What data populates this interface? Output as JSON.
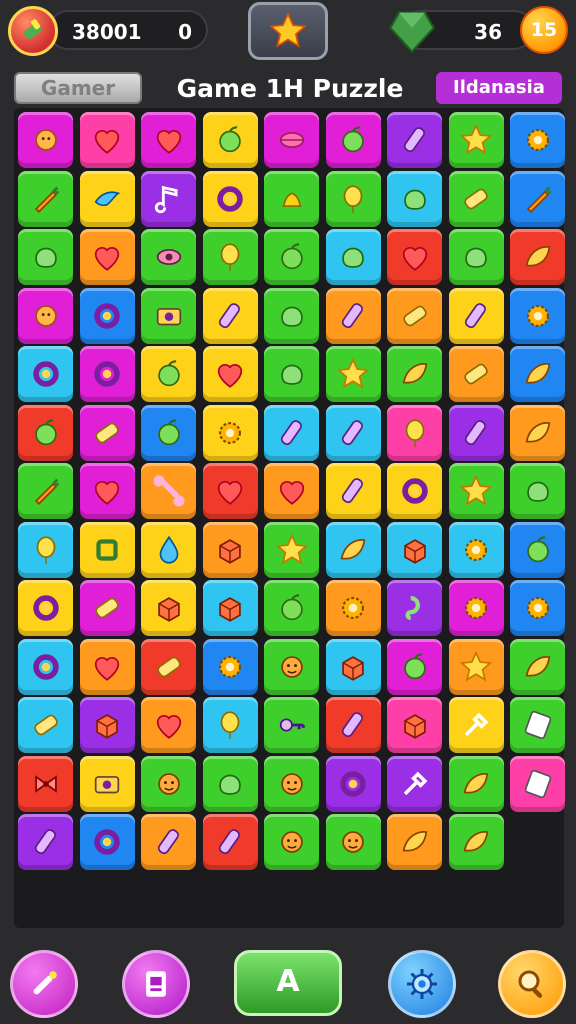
{
  "hud": {
    "score": "38001",
    "score_secondary": "0",
    "gems": "36",
    "coins": "15"
  },
  "header": {
    "games_label": "Gamer",
    "title": "Game 1H Puzzle",
    "region_label": "Ildanasia"
  },
  "board": {
    "cols": 9,
    "rows": 14,
    "tiles": [
      [
        "magenta",
        "flower"
      ],
      [
        "pink",
        "heart"
      ],
      [
        "magenta",
        "heart"
      ],
      [
        "yellow",
        "fruit"
      ],
      [
        "magenta",
        "lips"
      ],
      [
        "magenta",
        "fruit"
      ],
      [
        "purple",
        "bottle"
      ],
      [
        "green",
        "star"
      ],
      [
        "blue",
        "gear"
      ],
      [
        "green",
        "carrot"
      ],
      [
        "yellow",
        "bird"
      ],
      [
        "purple",
        "music"
      ],
      [
        "yellow",
        "ring"
      ],
      [
        "green",
        "bell"
      ],
      [
        "green",
        "balloon"
      ],
      [
        "cyan",
        "blob"
      ],
      [
        "green",
        "bar"
      ],
      [
        "blue",
        "carrot"
      ],
      [
        "green",
        "blob"
      ],
      [
        "orange",
        "heart"
      ],
      [
        "green",
        "eye"
      ],
      [
        "green",
        "balloon"
      ],
      [
        "green",
        "fruit"
      ],
      [
        "cyan",
        "blob"
      ],
      [
        "red",
        "heart"
      ],
      [
        "green",
        "blob"
      ],
      [
        "red",
        "leaf"
      ],
      [
        "magenta",
        "flower"
      ],
      [
        "blue",
        "ring"
      ],
      [
        "green",
        "camera"
      ],
      [
        "yellow",
        "bottle"
      ],
      [
        "green",
        "blob"
      ],
      [
        "orange",
        "bottle"
      ],
      [
        "orange",
        "bar"
      ],
      [
        "yellow",
        "bottle"
      ],
      [
        "blue",
        "gear"
      ],
      [
        "cyan",
        "ring"
      ],
      [
        "magenta",
        "ring"
      ],
      [
        "yellow",
        "fruit"
      ],
      [
        "yellow",
        "heart"
      ],
      [
        "green",
        "blob"
      ],
      [
        "green",
        "star"
      ],
      [
        "green",
        "leaf"
      ],
      [
        "orange",
        "bar"
      ],
      [
        "blue",
        "leaf"
      ],
      [
        "red",
        "fruit"
      ],
      [
        "magenta",
        "bar"
      ],
      [
        "blue",
        "fruit"
      ],
      [
        "yellow",
        "gear"
      ],
      [
        "cyan",
        "bottle"
      ],
      [
        "cyan",
        "bottle"
      ],
      [
        "pink",
        "balloon"
      ],
      [
        "purple",
        "bottle"
      ],
      [
        "orange",
        "leaf"
      ],
      [
        "green",
        "carrot"
      ],
      [
        "magenta",
        "heart"
      ],
      [
        "orange",
        "bone"
      ],
      [
        "red",
        "heart"
      ],
      [
        "orange",
        "heart"
      ],
      [
        "yellow",
        "bottle"
      ],
      [
        "yellow",
        "ring"
      ],
      [
        "green",
        "star"
      ],
      [
        "green",
        "blob"
      ],
      [
        "cyan",
        "balloon"
      ],
      [
        "yellow",
        "square"
      ],
      [
        "yellow",
        "drop"
      ],
      [
        "orange",
        "box"
      ],
      [
        "green",
        "star"
      ],
      [
        "cyan",
        "leaf"
      ],
      [
        "cyan",
        "box"
      ],
      [
        "cyan",
        "gear"
      ],
      [
        "blue",
        "fruit"
      ],
      [
        "yellow",
        "ring"
      ],
      [
        "magenta",
        "bar"
      ],
      [
        "yellow",
        "box"
      ],
      [
        "cyan",
        "box"
      ],
      [
        "green",
        "fruit"
      ],
      [
        "orange",
        "gear"
      ],
      [
        "purple",
        "hook"
      ],
      [
        "magenta",
        "gear"
      ],
      [
        "blue",
        "gear"
      ],
      [
        "cyan",
        "ring"
      ],
      [
        "orange",
        "heart"
      ],
      [
        "red",
        "bar"
      ],
      [
        "blue",
        "gear"
      ],
      [
        "green",
        "face"
      ],
      [
        "cyan",
        "box"
      ],
      [
        "magenta",
        "fruit"
      ],
      [
        "orange",
        "star"
      ],
      [
        "green",
        "leaf"
      ],
      [
        "cyan",
        "bar"
      ],
      [
        "purple",
        "box"
      ],
      [
        "orange",
        "heart"
      ],
      [
        "cyan",
        "balloon"
      ],
      [
        "green",
        "key"
      ],
      [
        "red",
        "bottle"
      ],
      [
        "pink",
        "box"
      ],
      [
        "yellow",
        "tool"
      ],
      [
        "green",
        "card"
      ],
      [
        "red",
        "bow"
      ],
      [
        "yellow",
        "camera"
      ],
      [
        "green",
        "face"
      ],
      [
        "green",
        "blob"
      ],
      [
        "green",
        "face"
      ],
      [
        "purple",
        "ring"
      ],
      [
        "purple",
        "tool"
      ],
      [
        "green",
        "leaf"
      ],
      [
        "pink",
        "card"
      ],
      [
        "purple",
        "bottle"
      ],
      [
        "blue",
        "ring"
      ],
      [
        "orange",
        "bottle"
      ],
      [
        "red",
        "bottle"
      ],
      [
        "green",
        "face"
      ],
      [
        "green",
        "face"
      ],
      [
        "orange",
        "leaf"
      ],
      [
        "green",
        "leaf"
      ],
      [
        "none",
        "none"
      ]
    ]
  },
  "colors": {
    "magenta": "#e11fd6",
    "pink": "#ff3fa8",
    "red": "#f03a2a",
    "orange": "#ff9a1f",
    "yellow": "#ffd21a",
    "green": "#3fcf2c",
    "cyan": "#2fc5f0",
    "blue": "#1f86f2",
    "purple": "#9a2fe6"
  },
  "bottom_bar": {
    "play_label": "A",
    "buttons": [
      "wand-icon",
      "card-icon",
      "gear-icon",
      "magnifier-icon"
    ]
  }
}
